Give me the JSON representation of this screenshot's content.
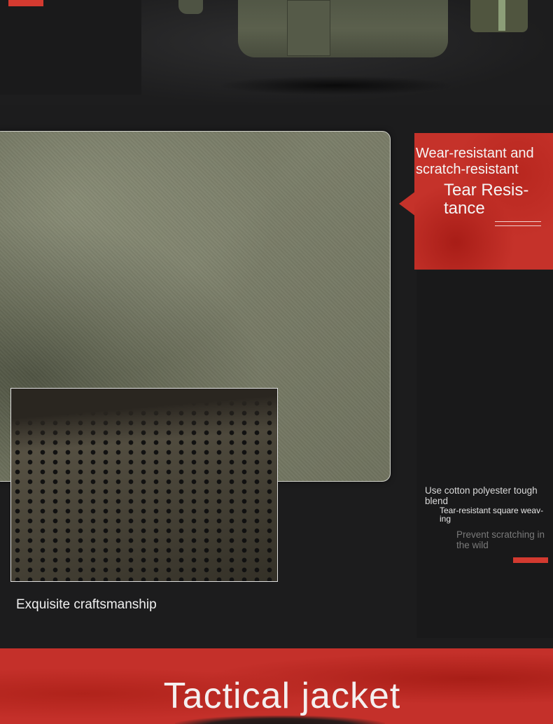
{
  "colors": {
    "accent_red": "#d33a30",
    "background": "#1c1c1d",
    "fabric_green": "#7b7e69"
  },
  "feature_box": {
    "subtitle": "Wear-resistant and scratch-resistant",
    "title": "Tear Resis- tance"
  },
  "features": {
    "line1": "Use cotton polyester tough blend",
    "line2": "Tear-resistant square weav- ing",
    "line3": "Prevent scratching in the wild"
  },
  "craft_caption": "Exquisite craftsmanship",
  "banner": {
    "title": "Tactical jacket"
  }
}
